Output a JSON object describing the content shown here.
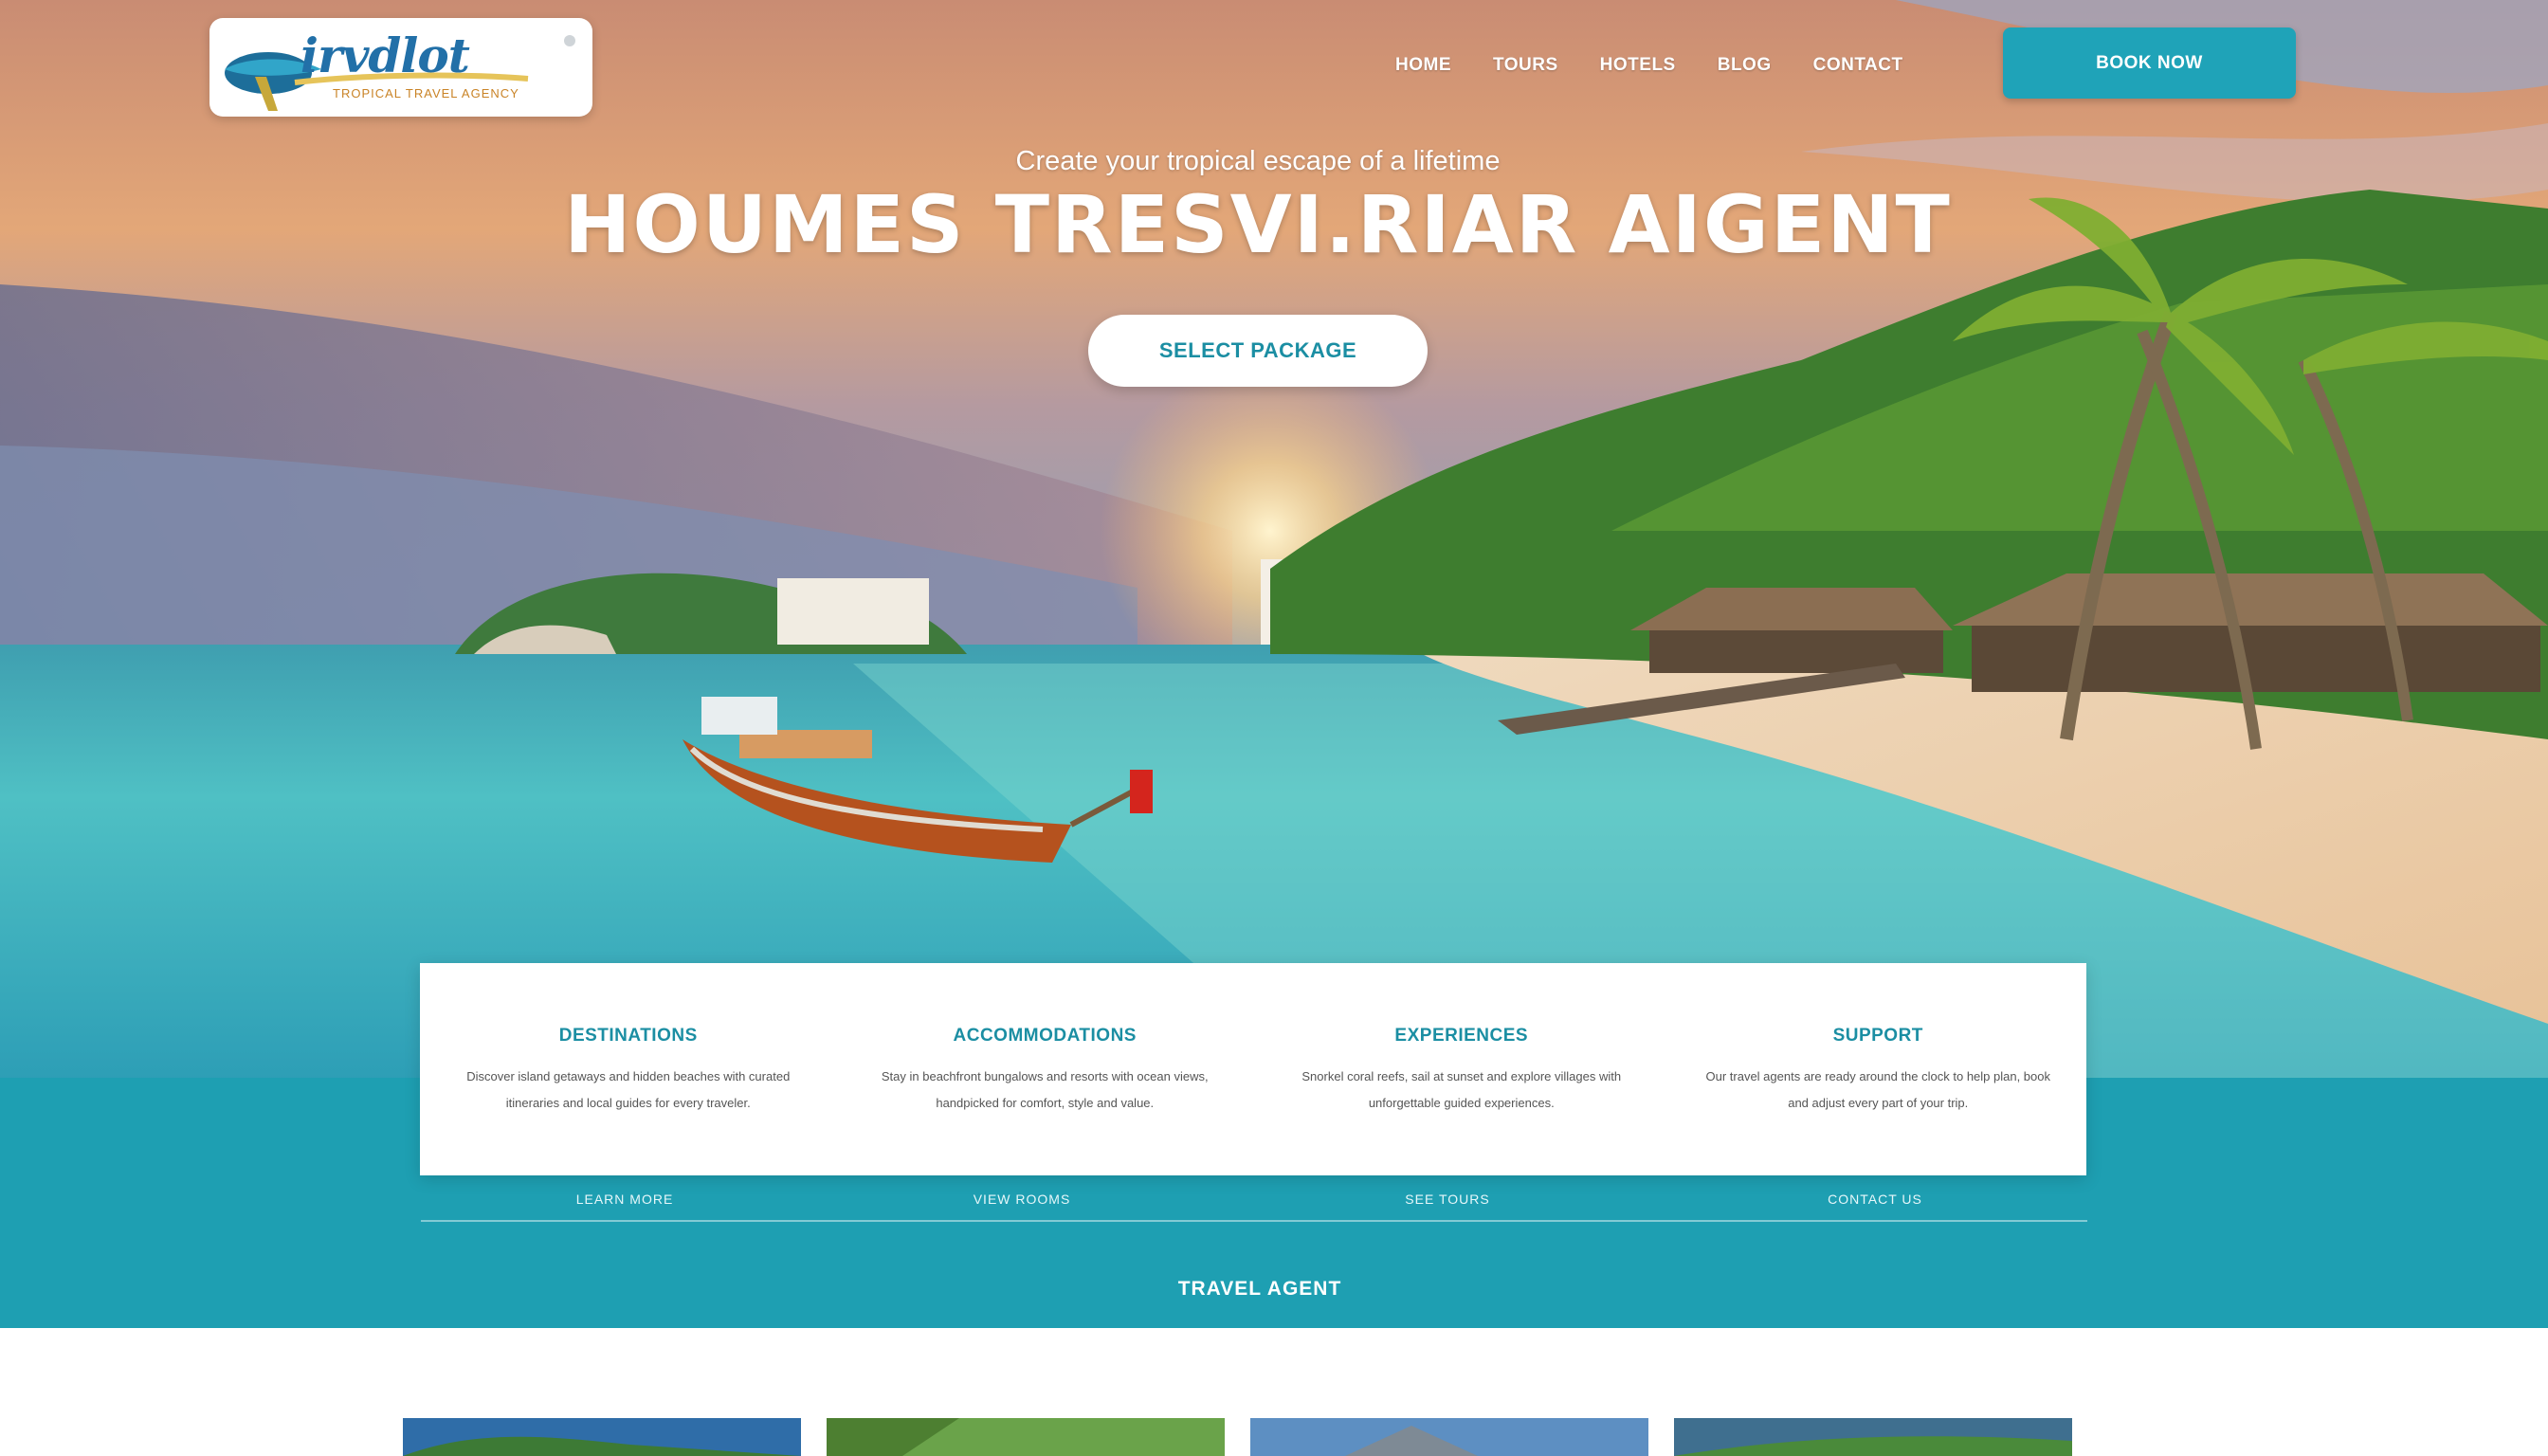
{
  "brand": {
    "logo_text": "irvdlot",
    "logo_tagline": "tropical travel agency"
  },
  "nav": {
    "items": [
      {
        "label": "Home"
      },
      {
        "label": "Tours"
      },
      {
        "label": "Hotels"
      },
      {
        "label": "Blog"
      },
      {
        "label": "Contact"
      }
    ],
    "cta_label": "Book Now"
  },
  "hero": {
    "eyebrow": "Create your tropical escape of a lifetime",
    "title": "HOUMES TRESVI.RIAR AIGENT",
    "button_label": "Select Package"
  },
  "features": [
    {
      "title": "Destinations",
      "text": "Discover island getaways and hidden beaches with curated itineraries and local guides for every traveler."
    },
    {
      "title": "Accommodations",
      "text": "Stay in beachfront bungalows and resorts with ocean views, handpicked for comfort, style and value."
    },
    {
      "title": "Experiences",
      "text": "Snorkel coral reefs, sail at sunset and explore villages with unforgettable guided experiences."
    },
    {
      "title": "Support",
      "text": "Our travel agents are ready around the clock to help plan, book and adjust every part of your trip."
    }
  ],
  "band": {
    "links": [
      {
        "label": "Learn more"
      },
      {
        "label": "View rooms"
      },
      {
        "label": "See tours"
      },
      {
        "label": "Contact us"
      }
    ],
    "cta_label": "Travel Agent"
  }
}
